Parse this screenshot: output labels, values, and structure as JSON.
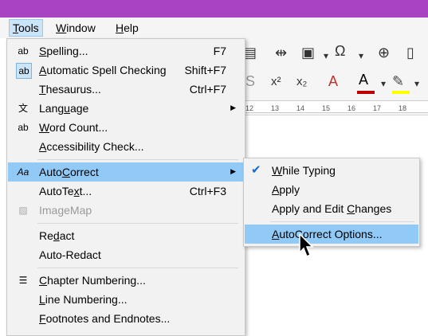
{
  "menubar": {
    "items": [
      {
        "label": "Tools",
        "key": "T",
        "rest": "ools"
      },
      {
        "label": "Window",
        "key": "W",
        "rest": "indow"
      },
      {
        "label": "Help",
        "key": "H",
        "rest": "elp"
      }
    ]
  },
  "tools_menu": {
    "spelling": {
      "key": "S",
      "rest": "pelling...",
      "shortcut": "F7"
    },
    "auto_spell": {
      "key": "A",
      "rest": "utomatic Spell Checking",
      "shortcut": "Shift+F7"
    },
    "thesaurus": {
      "key": "T",
      "rest": "hesaurus...",
      "shortcut": "Ctrl+F7"
    },
    "language": {
      "pre": "Lang",
      "key": "u",
      "rest": "age"
    },
    "word_count": {
      "key": "W",
      "rest": "ord Count..."
    },
    "accessibility": {
      "key": "A",
      "rest": "ccessibility Check..."
    },
    "autocorrect": {
      "pre": "Auto",
      "key": "C",
      "rest": "orrect"
    },
    "autotext": {
      "pre": "AutoTe",
      "key": "x",
      "rest": "t...",
      "shortcut": "Ctrl+F3"
    },
    "imagemap": {
      "label": "ImageMap"
    },
    "redact": {
      "pre": "Re",
      "key": "d",
      "rest": "act"
    },
    "auto_redact": {
      "label": "Auto-Redact"
    },
    "chapter_numbering": {
      "key": "C",
      "rest": "hapter Numbering..."
    },
    "line_numbering": {
      "key": "L",
      "rest": "ine Numbering..."
    },
    "footnotes": {
      "key": "F",
      "rest": "ootnotes and Endnotes..."
    }
  },
  "autocorrect_submenu": {
    "while_typing": {
      "key": "W",
      "rest": "hile Typing",
      "checked": true
    },
    "apply": {
      "key": "A",
      "rest": "pply"
    },
    "apply_edit": {
      "pre": "Apply and Edit ",
      "key": "C",
      "rest": "hanges"
    },
    "options": {
      "key": "A",
      "rest": "utoCorrect Options..."
    }
  },
  "toolbar": {
    "superscript": "x²",
    "subscript": "x₂",
    "omega": "Ω",
    "font_color_letter": "A"
  },
  "ruler": {
    "labels": [
      "12",
      "13",
      "14",
      "15",
      "16",
      "17",
      "18"
    ]
  },
  "colors": {
    "titlebar": "#a843c4",
    "highlight": "#91c9f7",
    "font_color": "#c00000",
    "highlight_color": "#ffff00"
  }
}
